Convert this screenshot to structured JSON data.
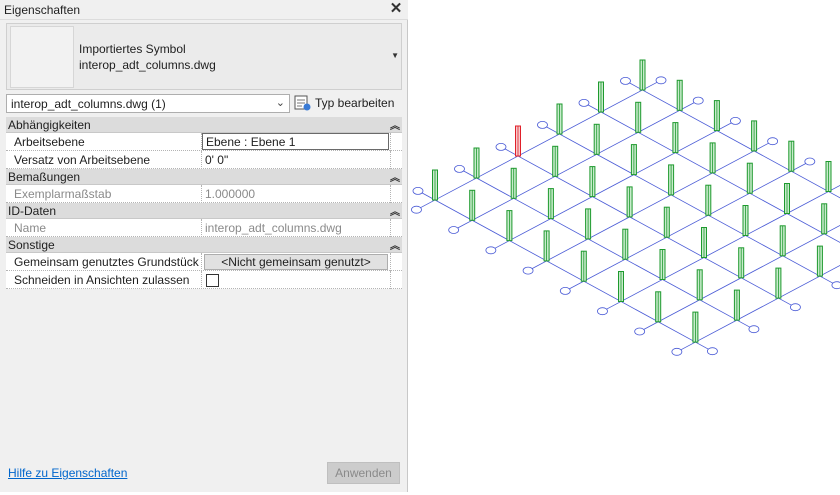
{
  "palette": {
    "title": "Eigenschaften",
    "type_selector": {
      "line1": "Importiertes Symbol",
      "line2": "interop_adt_columns.dwg"
    },
    "instance_filter": "interop_adt_columns.dwg (1)",
    "edit_type_label": "Typ bearbeiten",
    "groups": {
      "constraints": "Abhängigkeiten",
      "dimensions": "Bemaßungen",
      "identity": "ID-Daten",
      "other": "Sonstige"
    },
    "params": {
      "work_plane_name": "Arbeitsebene",
      "work_plane_value": "Ebene : Ebene 1",
      "offset_name": "Versatz von Arbeitsebene",
      "offset_value": "0'  0\"",
      "scale_name": "Exemplarmaßstab",
      "scale_value": "1.000000",
      "name_name": "Name",
      "name_value": "interop_adt_columns.dwg",
      "shared_site_name": "Gemeinsam genutztes Grundstück",
      "shared_site_value": "<Nicht gemeinsam genutzt>",
      "cut_name": "Schneiden in Ansichten zulassen"
    },
    "help_link": "Hilfe zu Eigenschaften",
    "apply_button": "Anwenden"
  },
  "view": {
    "grid_color": "#4a5bd6",
    "column_color": "#1e9a2e",
    "selected_column_color": "#e0202a"
  }
}
